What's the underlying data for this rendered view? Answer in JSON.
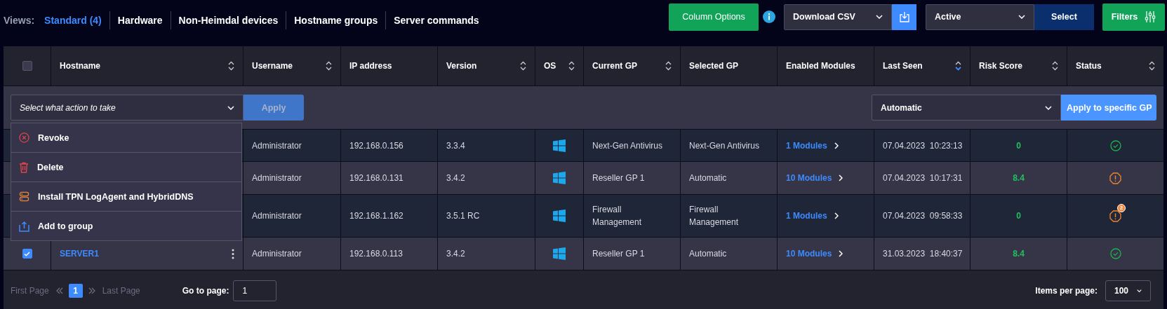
{
  "views": {
    "label": "Views:",
    "tabs": [
      {
        "label": "Standard (4)",
        "selected": true
      },
      {
        "label": "Hardware",
        "selected": false
      },
      {
        "label": "Non-Heimdal devices",
        "selected": false
      },
      {
        "label": "Hostname groups",
        "selected": false
      },
      {
        "label": "Server commands",
        "selected": false
      }
    ]
  },
  "toolbar": {
    "column_options": "Column Options",
    "download": {
      "value": "Download CSV"
    },
    "status_filter": {
      "value": "Active"
    },
    "select_button": "Select",
    "filters_button": "Filters"
  },
  "table": {
    "header_checkbox": {
      "checked": false
    },
    "columns": [
      {
        "label": "Hostname",
        "sortable": true,
        "sorted_desc": false
      },
      {
        "label": "Username",
        "sortable": true,
        "sorted_desc": false
      },
      {
        "label": "IP address",
        "sortable": false
      },
      {
        "label": "Version",
        "sortable": true,
        "sorted_desc": false
      },
      {
        "label": "OS",
        "sortable": true,
        "sorted_desc": false
      },
      {
        "label": "Current GP",
        "sortable": true,
        "sorted_desc": false
      },
      {
        "label": "Selected GP",
        "sortable": false
      },
      {
        "label": "Enabled Modules",
        "sortable": false
      },
      {
        "label": "Last Seen",
        "sortable": true,
        "sorted_desc": true
      },
      {
        "label": "Risk Score",
        "sortable": true,
        "sorted_desc": false
      },
      {
        "label": "Status",
        "sortable": true,
        "sorted_desc": false
      }
    ],
    "actions": {
      "action_select": {
        "placeholder": "Select what action to take"
      },
      "apply": "Apply",
      "gp_select": {
        "value": "Automatic"
      },
      "apply_gp": "Apply to specific GP",
      "menu": [
        {
          "kind": "revoke",
          "label": "Revoke"
        },
        {
          "kind": "delete",
          "label": "Delete"
        },
        {
          "kind": "install",
          "label": "Install TPN LogAgent and HybridDNS"
        },
        {
          "kind": "group",
          "label": "Add to group"
        }
      ]
    },
    "rows": [
      {
        "username": "Administrator",
        "ip": "192.168.0.156",
        "version": "3.3.4",
        "current_gp": "Next-Gen Antivirus",
        "selected_gp": "Next-Gen Antivirus",
        "modules": "1 Modules",
        "last_seen": "07.04.2023  10:23:13",
        "risk_score": "0",
        "status": {
          "kind": "ok"
        }
      },
      {
        "username": "Administrator",
        "ip": "192.168.0.131",
        "version": "3.4.2",
        "current_gp": "Reseller GP 1",
        "selected_gp": "Automatic",
        "modules": "10 Modules",
        "last_seen": "07.04.2023  10:17:31",
        "risk_score": "8.4",
        "status": {
          "kind": "warning"
        }
      },
      {
        "username": "Administrator",
        "ip": "192.168.1.162",
        "version": "3.5.1 RC",
        "current_gp": "Firewall Management",
        "selected_gp": "Firewall Management",
        "modules": "1 Modules",
        "last_seen": "07.04.2023  09:58:33",
        "risk_score": "0",
        "status": {
          "kind": "warning",
          "badge": "2"
        }
      },
      {
        "checked": true,
        "hostname": "SERVER1",
        "username": "Administrator",
        "ip": "192.168.0.113",
        "version": "3.4.2",
        "current_gp": "Reseller GP 1",
        "selected_gp": "Automatic",
        "modules": "10 Modules",
        "last_seen": "31.03.2023  18:40:37",
        "risk_score": "8.4",
        "status": {
          "kind": "ok"
        }
      }
    ]
  },
  "pagination": {
    "first": "First Page",
    "pages": [
      {
        "label": "1",
        "selected": true
      }
    ],
    "last": "Last Page",
    "goto_label": "Go to page:",
    "goto_value": "1",
    "per_page_label": "Items per page:",
    "per_page_value": "100"
  }
}
